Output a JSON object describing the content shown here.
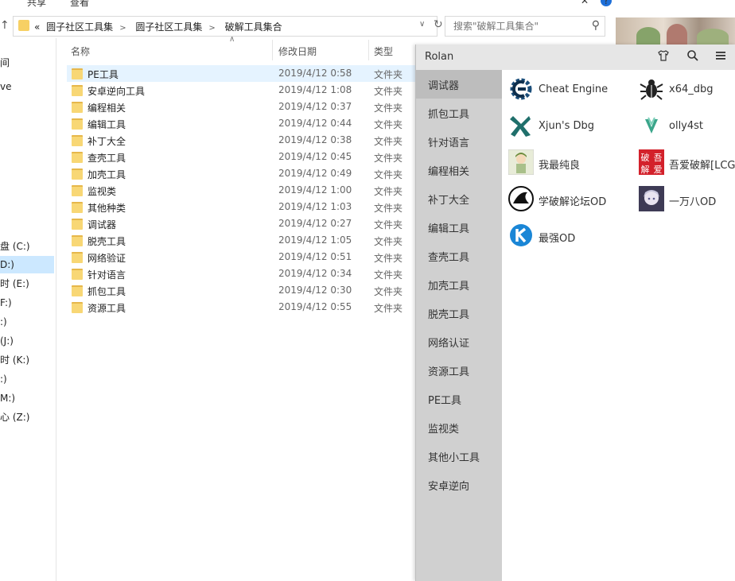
{
  "explorer": {
    "ribbon_tabs": [
      "共享",
      "查看"
    ],
    "help_icon": "?",
    "address": {
      "crumbs": [
        "«",
        "圆子社区工具集",
        "圆子社区工具集",
        "破解工具集合"
      ],
      "separator": ">"
    },
    "search": {
      "placeholder": "搜索\"破解工具集合\""
    },
    "nav_pane": [
      "间",
      "ve",
      "盘 (C:)",
      "D:)",
      "时 (E:)",
      "F:)",
      ":)",
      "(J:)",
      "时 (K:)",
      ":)",
      "M:)",
      "心 (Z:)"
    ],
    "columns": {
      "name": "名称",
      "date": "修改日期",
      "type": "类型"
    },
    "files": [
      {
        "name": "PE工具",
        "date": "2019/4/12 0:58",
        "type": "文件夹"
      },
      {
        "name": "安卓逆向工具",
        "date": "2019/4/12 1:08",
        "type": "文件夹"
      },
      {
        "name": "编程相关",
        "date": "2019/4/12 0:37",
        "type": "文件夹"
      },
      {
        "name": "编辑工具",
        "date": "2019/4/12 0:44",
        "type": "文件夹"
      },
      {
        "name": "补丁大全",
        "date": "2019/4/12 0:38",
        "type": "文件夹"
      },
      {
        "name": "查壳工具",
        "date": "2019/4/12 0:45",
        "type": "文件夹"
      },
      {
        "name": "加壳工具",
        "date": "2019/4/12 0:49",
        "type": "文件夹"
      },
      {
        "name": "监视类",
        "date": "2019/4/12 1:00",
        "type": "文件夹"
      },
      {
        "name": "其他种类",
        "date": "2019/4/12 1:03",
        "type": "文件夹"
      },
      {
        "name": "调试器",
        "date": "2019/4/12 0:27",
        "type": "文件夹"
      },
      {
        "name": "脱壳工具",
        "date": "2019/4/12 1:05",
        "type": "文件夹"
      },
      {
        "name": "网络验证",
        "date": "2019/4/12 0:51",
        "type": "文件夹"
      },
      {
        "name": "针对语言",
        "date": "2019/4/12 0:34",
        "type": "文件夹"
      },
      {
        "name": "抓包工具",
        "date": "2019/4/12 0:30",
        "type": "文件夹"
      },
      {
        "name": "资源工具",
        "date": "2019/4/12 0:55",
        "type": "文件夹"
      }
    ]
  },
  "rolan": {
    "title": "Rolan",
    "title_icons": [
      "shirt-icon",
      "search-icon",
      "menu-icon"
    ],
    "categories": [
      "调试器",
      "抓包工具",
      "针对语言",
      "编程相关",
      "补丁大全",
      "编辑工具",
      "查壳工具",
      "加壳工具",
      "脱壳工具",
      "网络认证",
      "资源工具",
      "PE工具",
      "监视类",
      "其他小工具",
      "安卓逆向"
    ],
    "selected_category": "调试器",
    "apps": [
      {
        "label": "Cheat Engine",
        "icon": "cheat-engine-icon",
        "color": "#1b4e7a"
      },
      {
        "label": "x64_dbg",
        "icon": "bug-icon",
        "color": "#222222"
      },
      {
        "label": "Xjun's Dbg",
        "icon": "xjun-dbg-icon",
        "color": "#1f6f6b"
      },
      {
        "label": "olly4st",
        "icon": "olly-icon",
        "color": "#3aa58a"
      },
      {
        "label": "我最纯良",
        "icon": "cartoon-avatar-icon",
        "color": "#a9c08a"
      },
      {
        "label": "吾爱破解[LCG]",
        "icon": "52pojie-icon",
        "color": "#d3212b"
      },
      {
        "label": "学破解论坛OD",
        "icon": "shark-fin-icon",
        "color": "#111111"
      },
      {
        "label": "一万八OD",
        "icon": "anime-avatar-icon",
        "color": "#6e6c8a"
      },
      {
        "label": "最强OD",
        "icon": "k-logo-icon",
        "color": "#1a86d6"
      }
    ],
    "logo_text": {
      "52pojie": [
        "破",
        "吾",
        "解",
        "爱"
      ]
    }
  }
}
